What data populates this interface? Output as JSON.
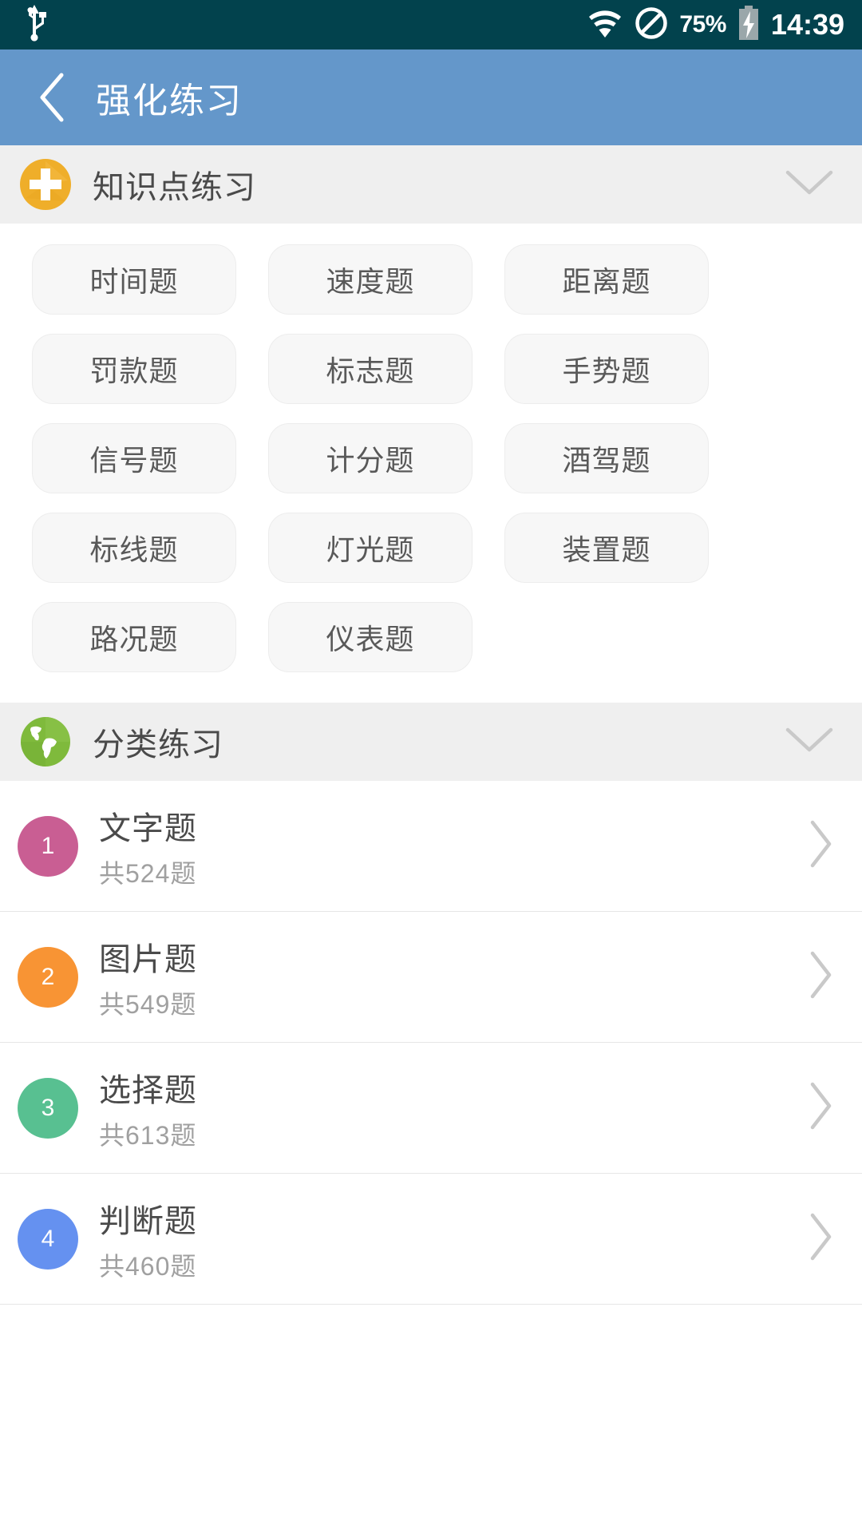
{
  "statusbar": {
    "usb_icon": "usb-icon",
    "wifi_icon": "wifi-icon",
    "dnd_icon": "do-not-disturb-icon",
    "battery_percent": "75%",
    "battery_icon": "battery-charging-icon",
    "time": "14:39"
  },
  "appbar": {
    "back_icon": "back-chevron-icon",
    "title": "强化练习",
    "background": "#6497CA"
  },
  "sections": [
    {
      "icon": "plus-circle-icon",
      "icon_color": "#EFAE2A",
      "title": "知识点练习",
      "expand_icon": "chevron-down-icon",
      "chips": [
        "时间题",
        "速度题",
        "距离题",
        "罚款题",
        "标志题",
        "手势题",
        "信号题",
        "计分题",
        "酒驾题",
        "标线题",
        "灯光题",
        "装置题",
        "路况题",
        "仪表题"
      ]
    },
    {
      "icon": "globe-icon",
      "icon_color": "#7FBA3C",
      "title": "分类练习",
      "expand_icon": "chevron-down-icon",
      "items": [
        {
          "number": "1",
          "color": "#C95E93",
          "title": "文字题",
          "subtitle": "共524题",
          "chevron": "chevron-right-icon"
        },
        {
          "number": "2",
          "color": "#F89434",
          "title": "图片题",
          "subtitle": "共549题",
          "chevron": "chevron-right-icon"
        },
        {
          "number": "3",
          "color": "#58C091",
          "title": "选择题",
          "subtitle": "共613题",
          "chevron": "chevron-right-icon"
        },
        {
          "number": "4",
          "color": "#6591F0",
          "title": "判断题",
          "subtitle": "共460题",
          "chevron": "chevron-right-icon"
        }
      ]
    }
  ]
}
